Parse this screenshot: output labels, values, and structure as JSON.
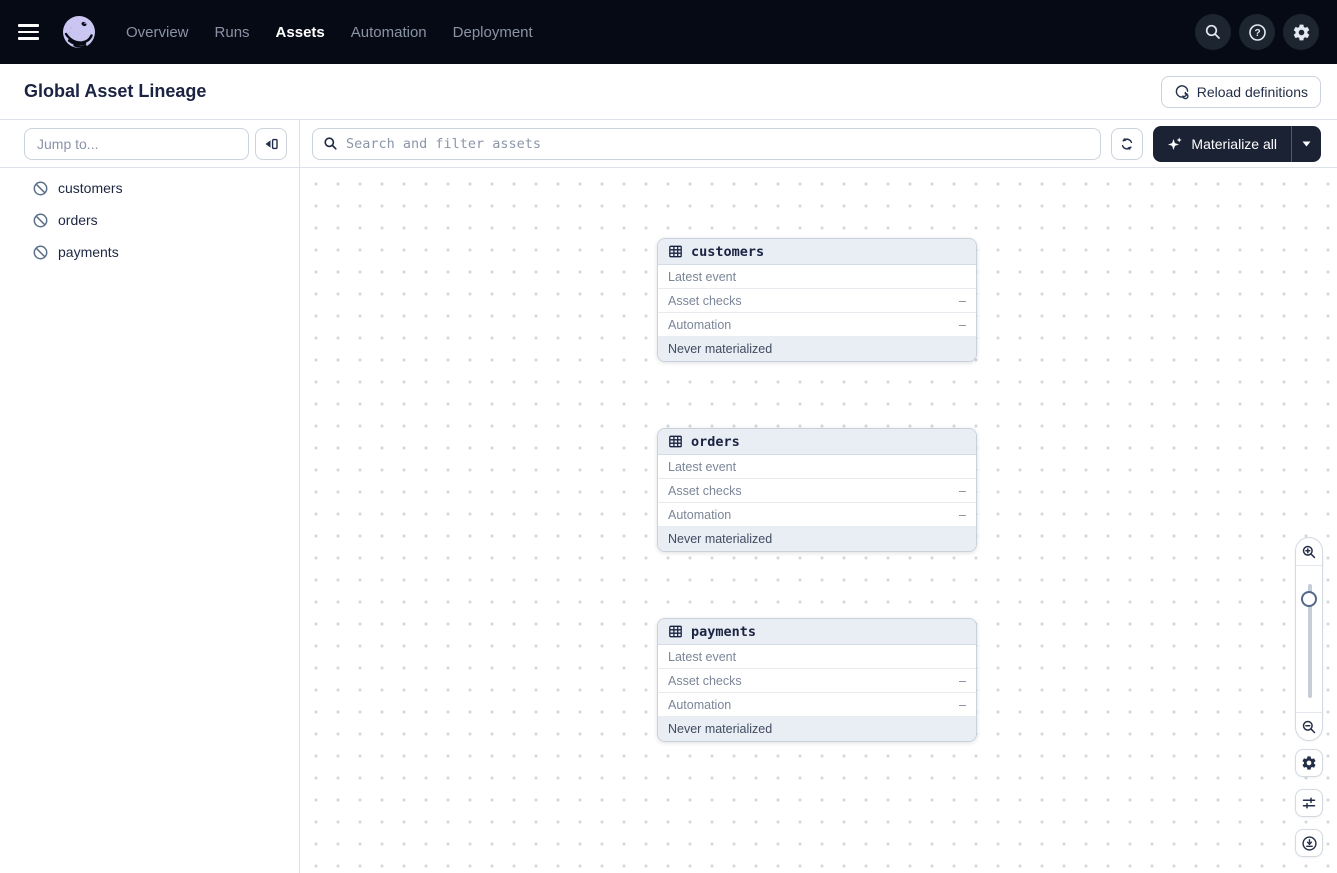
{
  "colors": {
    "topnav_bg": "#050a14",
    "brand_lavender": "#cac6f1",
    "dark_navy": "#1a2342",
    "primary_button_bg": "#1a2234",
    "muted_text": "#7b8698",
    "node_header_bg": "#e9edf4",
    "border": "#dde2e8"
  },
  "nav": {
    "items": [
      {
        "label": "Overview",
        "active": false
      },
      {
        "label": "Runs",
        "active": false
      },
      {
        "label": "Assets",
        "active": true
      },
      {
        "label": "Automation",
        "active": false
      },
      {
        "label": "Deployment",
        "active": false
      }
    ]
  },
  "page_header": {
    "title": "Global Asset Lineage",
    "reload_button_label": "Reload definitions"
  },
  "sidebar": {
    "jump_input_placeholder": "Jump to...",
    "assets": [
      {
        "name": "customers"
      },
      {
        "name": "orders"
      },
      {
        "name": "payments"
      }
    ]
  },
  "toolbar": {
    "search_placeholder": "Search and filter assets",
    "materialize_button_label": "Materialize all"
  },
  "graph": {
    "nodes": [
      {
        "name": "customers",
        "rows": [
          {
            "label": "Latest event",
            "value": ""
          },
          {
            "label": "Asset checks",
            "value": "–"
          },
          {
            "label": "Automation",
            "value": "–"
          }
        ],
        "footer": "Never materialized"
      },
      {
        "name": "orders",
        "rows": [
          {
            "label": "Latest event",
            "value": ""
          },
          {
            "label": "Asset checks",
            "value": "–"
          },
          {
            "label": "Automation",
            "value": "–"
          }
        ],
        "footer": "Never materialized"
      },
      {
        "name": "payments",
        "rows": [
          {
            "label": "Latest event",
            "value": ""
          },
          {
            "label": "Asset checks",
            "value": "–"
          },
          {
            "label": "Automation",
            "value": "–"
          }
        ],
        "footer": "Never materialized"
      }
    ]
  },
  "icons": {
    "nav": [
      "menu-icon",
      "dagster-logo",
      "search-icon",
      "help-icon",
      "settings-icon"
    ],
    "header": [
      "reload-definitions-icon"
    ],
    "sidebar": [
      "collapse-panel-icon",
      "asset-hidden-icon"
    ],
    "toolbar": [
      "search-icon",
      "refresh-icon",
      "sparkles-icon",
      "caret-down-icon"
    ],
    "graph": [
      "table-icon",
      "zoom-in-icon",
      "zoom-out-icon",
      "settings-gear-icon",
      "filters-icon",
      "recenter-icon"
    ]
  }
}
